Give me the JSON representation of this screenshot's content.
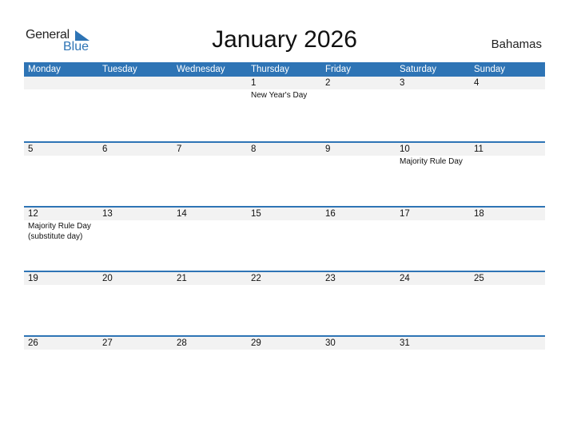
{
  "logo": {
    "general": "General",
    "blue": "Blue"
  },
  "title": "January 2026",
  "country": "Bahamas",
  "colors": {
    "accent": "#2e74b5",
    "band": "#f2f2f2"
  },
  "weekdays": [
    "Monday",
    "Tuesday",
    "Wednesday",
    "Thursday",
    "Friday",
    "Saturday",
    "Sunday"
  ],
  "weeks": [
    {
      "days": [
        "",
        "",
        "",
        "1",
        "2",
        "3",
        "4"
      ],
      "holidays": [
        "",
        "",
        "",
        "New Year's Day",
        "",
        "",
        ""
      ]
    },
    {
      "days": [
        "5",
        "6",
        "7",
        "8",
        "9",
        "10",
        "11"
      ],
      "holidays": [
        "",
        "",
        "",
        "",
        "",
        "Majority Rule Day",
        ""
      ]
    },
    {
      "days": [
        "12",
        "13",
        "14",
        "15",
        "16",
        "17",
        "18"
      ],
      "holidays": [
        "Majority Rule Day (substitute day)",
        "",
        "",
        "",
        "",
        "",
        ""
      ]
    },
    {
      "days": [
        "19",
        "20",
        "21",
        "22",
        "23",
        "24",
        "25"
      ],
      "holidays": [
        "",
        "",
        "",
        "",
        "",
        "",
        ""
      ]
    },
    {
      "days": [
        "26",
        "27",
        "28",
        "29",
        "30",
        "31",
        ""
      ],
      "holidays": [
        "",
        "",
        "",
        "",
        "",
        "",
        ""
      ]
    }
  ]
}
